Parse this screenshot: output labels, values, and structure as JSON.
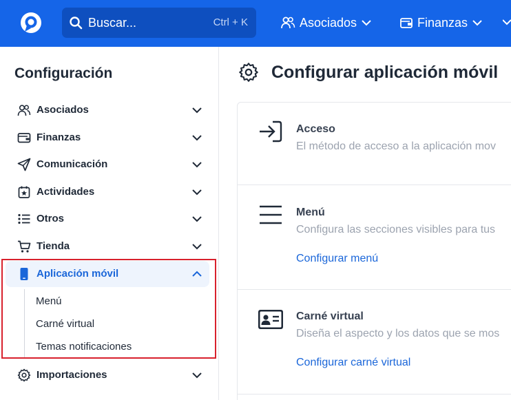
{
  "topbar": {
    "search": {
      "placeholder": "Buscar...",
      "shortcut": "Ctrl + K"
    },
    "nav": [
      {
        "label": "Asociados",
        "icon": "users-icon"
      },
      {
        "label": "Finanzas",
        "icon": "wallet-icon"
      }
    ],
    "colors": {
      "bar": "#1565e8",
      "search_bg": "#0e4fbf"
    }
  },
  "sidebar": {
    "title": "Configuración",
    "items": [
      {
        "label": "Asociados",
        "icon": "users-icon"
      },
      {
        "label": "Finanzas",
        "icon": "wallet-icon"
      },
      {
        "label": "Comunicación",
        "icon": "send-icon"
      },
      {
        "label": "Actividades",
        "icon": "calendar-star-icon"
      },
      {
        "label": "Otros",
        "icon": "list-icon"
      },
      {
        "label": "Tienda",
        "icon": "cart-icon"
      },
      {
        "label": "Aplicación móvil",
        "icon": "phone-icon",
        "expanded": true
      },
      {
        "label": "Importaciones",
        "icon": "gear-icon"
      }
    ],
    "subitems": [
      "Menú",
      "Carné virtual",
      "Temas notificaciones"
    ],
    "active_color": "#1a66d9",
    "highlight_color": "#d8202c"
  },
  "main": {
    "title": "Configurar aplicación móvil",
    "sections": [
      {
        "icon": "sign-in-icon",
        "title": "Acceso",
        "description": "El método de acceso a la aplicación mov",
        "link": ""
      },
      {
        "icon": "menu-icon",
        "title": "Menú",
        "description": "Configura las secciones visibles para tus",
        "link": "Configurar menú"
      },
      {
        "icon": "id-card-icon",
        "title": "Carné virtual",
        "description": "Diseña el aspecto y los datos que se mos",
        "link": "Configurar carné virtual"
      }
    ]
  }
}
